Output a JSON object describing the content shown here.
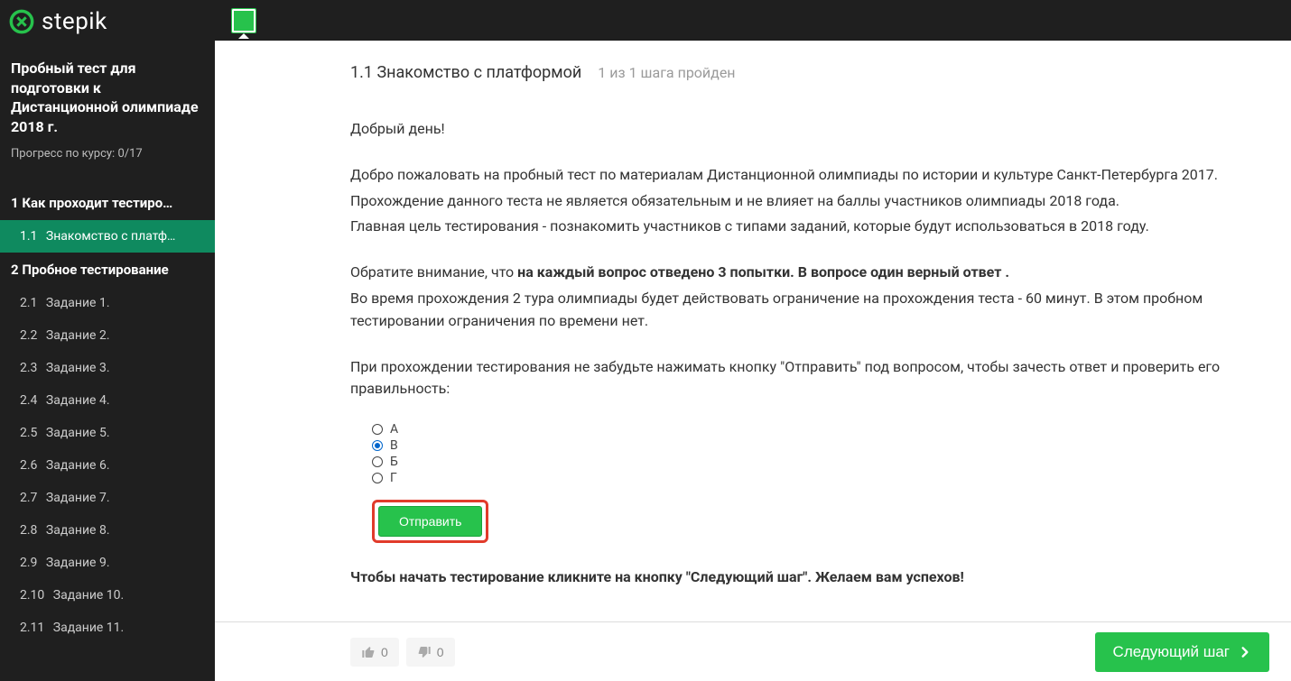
{
  "brand": {
    "name": "stepik"
  },
  "course": {
    "title": "Пробный тест для подготовки к Дистанционной олимпиаде 2018 г.",
    "progress_label": "Прогресс по курсу:",
    "progress_value": "0/17"
  },
  "sections": [
    {
      "num": "1",
      "title": "Как проходит тестиро…",
      "items": [
        {
          "num": "1.1",
          "title": "Знакомство с платф…",
          "active": true
        }
      ]
    },
    {
      "num": "2",
      "title": "Пробное тестирование",
      "items": [
        {
          "num": "2.1",
          "title": "Задание 1."
        },
        {
          "num": "2.2",
          "title": "Задание 2."
        },
        {
          "num": "2.3",
          "title": "Задание 3."
        },
        {
          "num": "2.4",
          "title": "Задание 4."
        },
        {
          "num": "2.5",
          "title": "Задание 5."
        },
        {
          "num": "2.6",
          "title": "Задание 6."
        },
        {
          "num": "2.7",
          "title": "Задание 7."
        },
        {
          "num": "2.8",
          "title": "Задание 8."
        },
        {
          "num": "2.9",
          "title": "Задание 9."
        },
        {
          "num": "2.10",
          "title": "Задание 10."
        },
        {
          "num": "2.11",
          "title": "Задание 11."
        }
      ]
    }
  ],
  "lesson": {
    "title": "1.1 Знакомство с платформой",
    "step_progress": "1 из 1 шага пройден"
  },
  "content": {
    "greeting": "Добрый день!",
    "p1": "Добро пожаловать на пробный тест по материалам Дистанционной олимпиады по истории и культуре Санкт-Петербурга 2017.",
    "p2": "Прохождение данного теста не является обязательным и не влияет на баллы участников олимпиады 2018 года.",
    "p3": "Главная цель тестирования - познакомить участников с типами заданий, которые будут использоваться в 2018 году.",
    "note_prefix": "Обратите внимание, что ",
    "note_bold": "на каждый вопрос отведено 3 попытки. В вопросе один верный ответ .",
    "p4": "Во время прохождения 2 тура олимпиады будет действовать ограничение на прохождения теста - 60 минут. В этом пробном тестировании ограничения по времени нет.",
    "p5": "При прохождении тестирования не забудьте нажимать кнопку \"Отправить\" под вопросом, чтобы зачесть ответ и проверить его правильность:",
    "options": [
      "А",
      "В",
      "Б",
      "Г"
    ],
    "selected_index": 1,
    "submit_label": "Отправить",
    "start_line": "Чтобы начать тестирование кликните на кнопку \"Следующий шаг\". Желаем вам успехов!"
  },
  "footer": {
    "likes": "0",
    "dislikes": "0",
    "next_label": "Следующий шаг"
  }
}
